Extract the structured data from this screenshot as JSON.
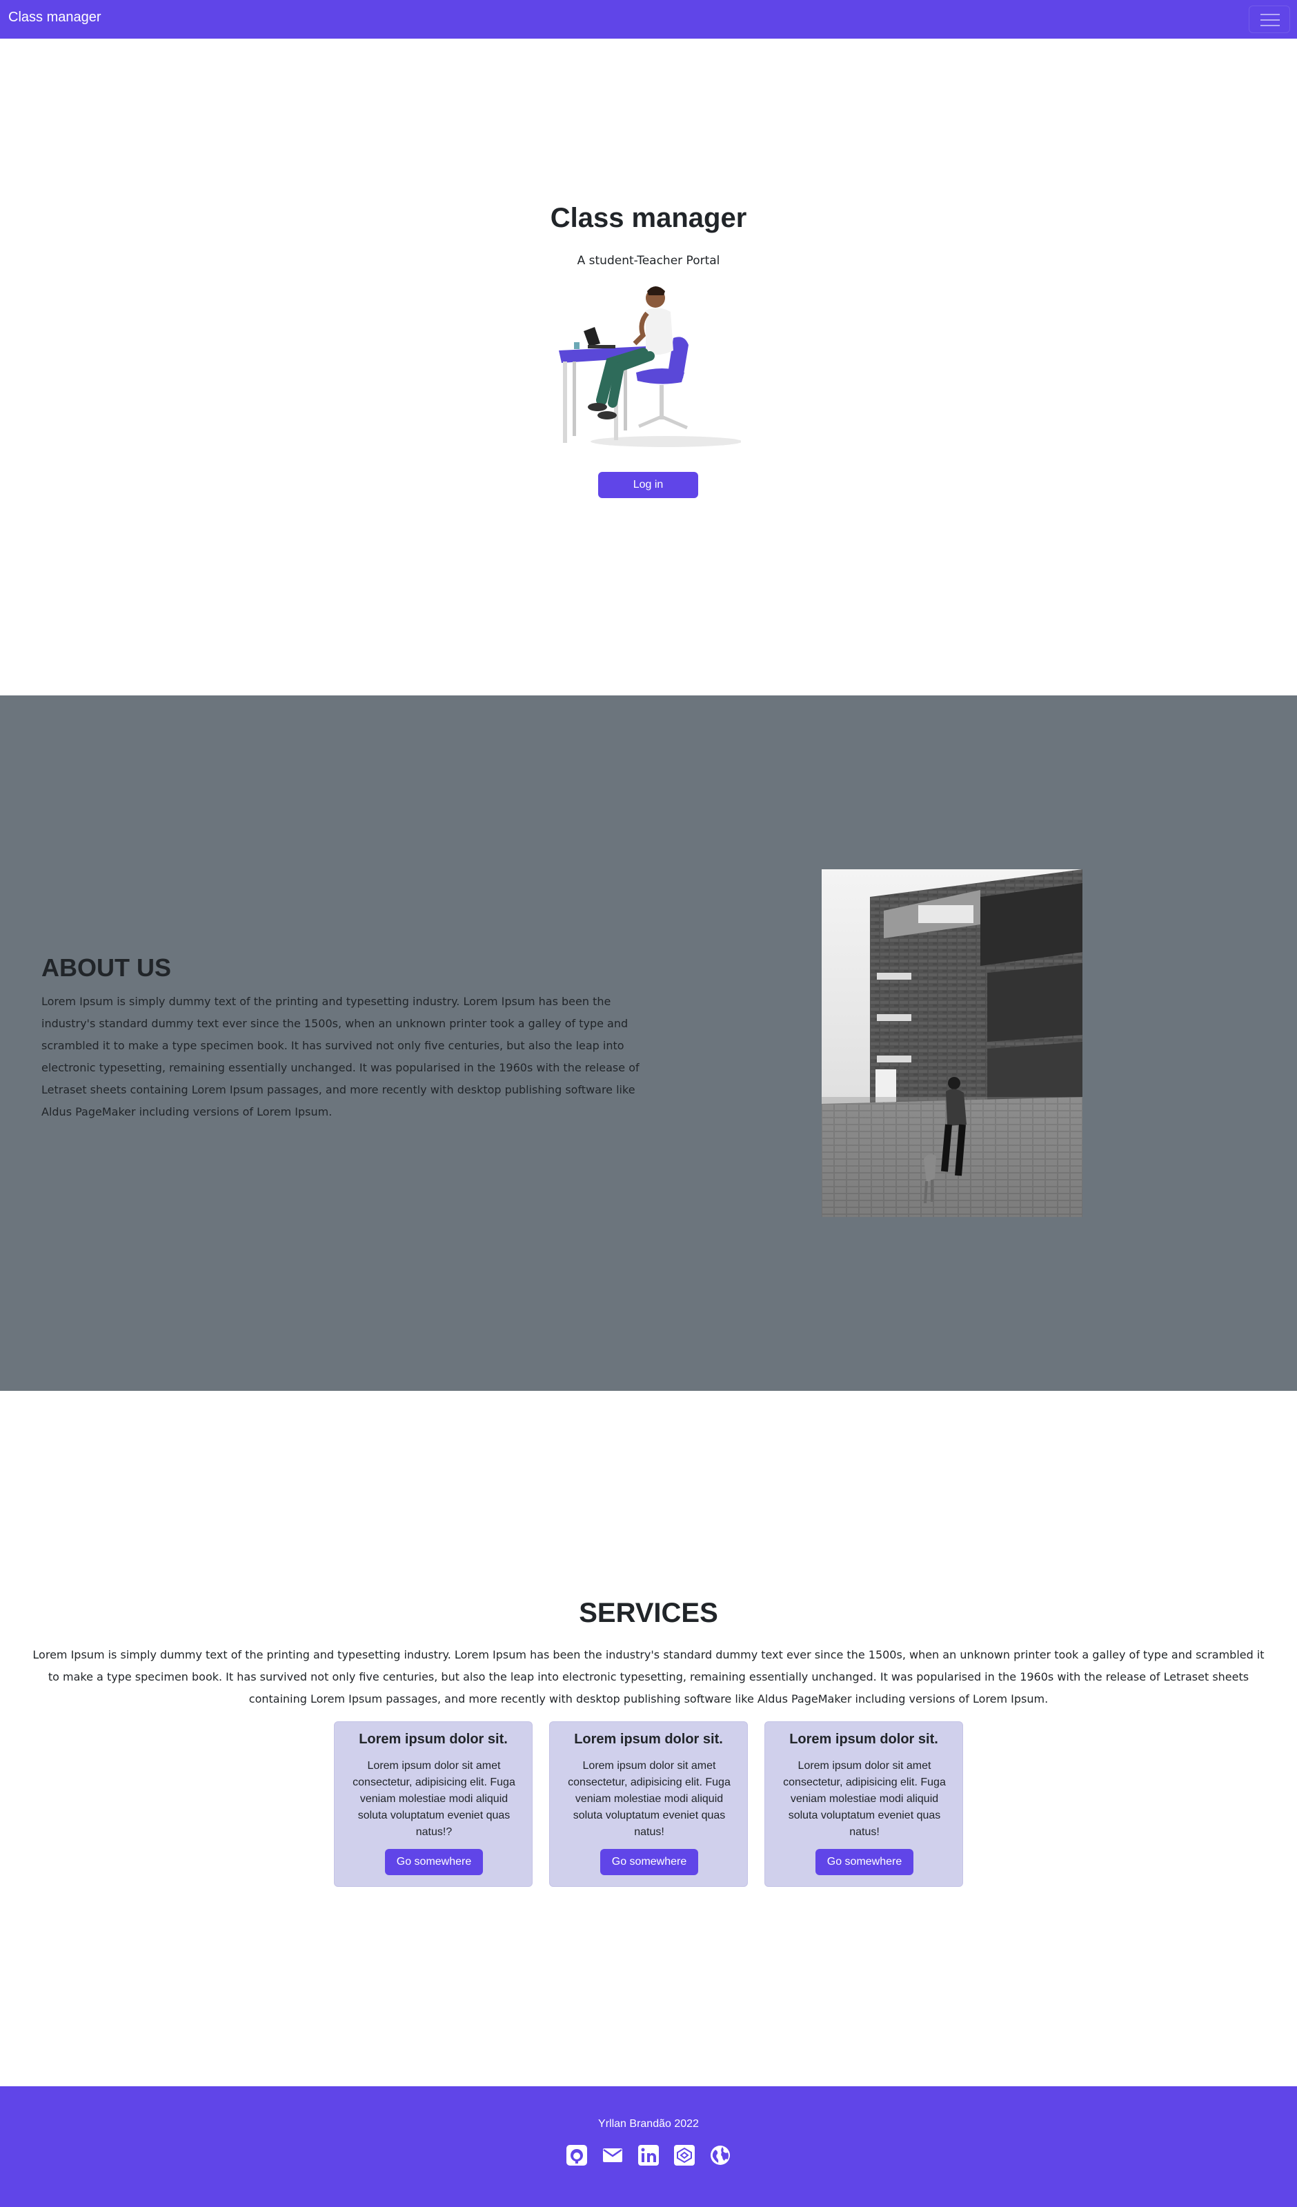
{
  "navbar": {
    "brand": "Class manager",
    "toggler_icon": "hamburger-icon",
    "bg_color": "#6045e8"
  },
  "hero": {
    "title": "Class manager",
    "subtitle": "A student-Teacher Portal",
    "login_label": "Log in",
    "illustration": "person-at-desk-on-phone-illustration"
  },
  "about": {
    "title": "ABOUT US",
    "text": "Lorem Ipsum is simply dummy text of the printing and typesetting industry. Lorem Ipsum has been the industry's standard dummy text ever since the 1500s, when an unknown printer took a galley of type and scrambled it to make a type specimen book. It has survived not only five centuries, but also the leap into electronic typesetting, remaining essentially unchanged. It was popularised in the 1960s with the release of Letraset sheets containing Lorem Ipsum passages, and more recently with desktop publishing software like Aldus PageMaker including versions of Lorem Ipsum.",
    "photo": "black-and-white-campus-building-photo",
    "bg_color": "#6c757d"
  },
  "services": {
    "title": "SERVICES",
    "text": "Lorem Ipsum is simply dummy text of the printing and typesetting industry. Lorem Ipsum has been the industry's standard dummy text ever since the 1500s, when an unknown printer took a galley of type and scrambled it to make a type specimen book. It has survived not only five centuries, but also the leap into electronic typesetting, remaining essentially unchanged. It was popularised in the 1960s with the release of Letraset sheets containing Lorem Ipsum passages, and more recently with desktop publishing software like Aldus PageMaker including versions of Lorem Ipsum.",
    "cards": [
      {
        "title": "Lorem ipsum dolor sit.",
        "text": "Lorem ipsum dolor sit amet consectetur, adipisicing elit. Fuga veniam molestiae modi aliquid soluta voluptatum eveniet quas natus!?",
        "button": "Go somewhere"
      },
      {
        "title": "Lorem ipsum dolor sit.",
        "text": "Lorem ipsum dolor sit amet consectetur, adipisicing elit. Fuga veniam molestiae modi aliquid soluta voluptatum eveniet quas natus!",
        "button": "Go somewhere"
      },
      {
        "title": "Lorem ipsum dolor sit.",
        "text": "Lorem ipsum dolor sit amet consectetur, adipisicing elit. Fuga veniam molestiae modi aliquid soluta voluptatum eveniet quas natus!",
        "button": "Go somewhere"
      }
    ],
    "card_color": "#d0d0ec"
  },
  "footer": {
    "credit": "Yrllan Brandão 2022",
    "icons": [
      "github-icon",
      "email-icon",
      "linkedin-icon",
      "codepen-icon",
      "globe-icon"
    ]
  }
}
